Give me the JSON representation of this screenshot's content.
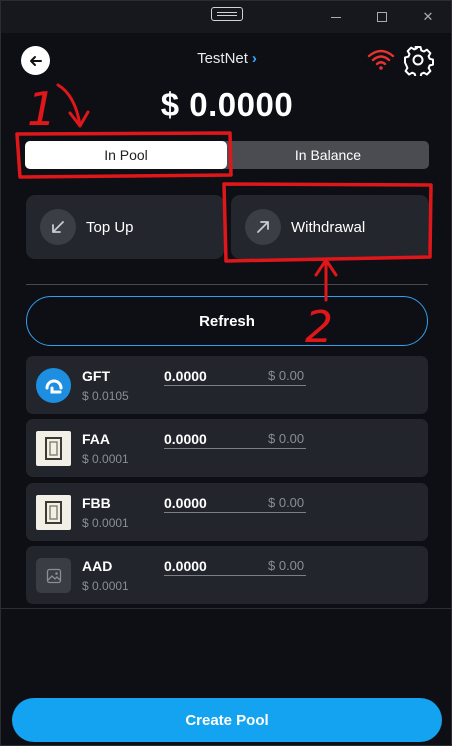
{
  "header": {
    "network": "TestNet",
    "network_chevron": "›",
    "balance": "$ 0.0000"
  },
  "tabs": [
    {
      "label": "In Pool",
      "active": true
    },
    {
      "label": "In Balance",
      "active": false
    }
  ],
  "actions": {
    "top_up": "Top Up",
    "withdrawal": "Withdrawal"
  },
  "refresh_label": "Refresh",
  "tokens": [
    {
      "symbol": "GFT",
      "amount": "0.0000",
      "usd": "$ 0.00",
      "price": "$ 0.0105",
      "icon": "gft-logo"
    },
    {
      "symbol": "FAA",
      "amount": "0.0000",
      "usd": "$ 0.00",
      "price": "$ 0.0001",
      "icon": "token-image"
    },
    {
      "symbol": "FBB",
      "amount": "0.0000",
      "usd": "$ 0.00",
      "price": "$ 0.0001",
      "icon": "token-image"
    },
    {
      "symbol": "AAD",
      "amount": "0.0000",
      "usd": "$ 0.00",
      "price": "$ 0.0001",
      "icon": "image-placeholder"
    }
  ],
  "create_pool_label": "Create Pool",
  "annotations": [
    {
      "label": "1"
    },
    {
      "label": "2"
    }
  ],
  "colors": {
    "accent": "#13a3f0",
    "annotation": "#e0171a",
    "wifi": "#e8322f",
    "card": "#22252b"
  }
}
